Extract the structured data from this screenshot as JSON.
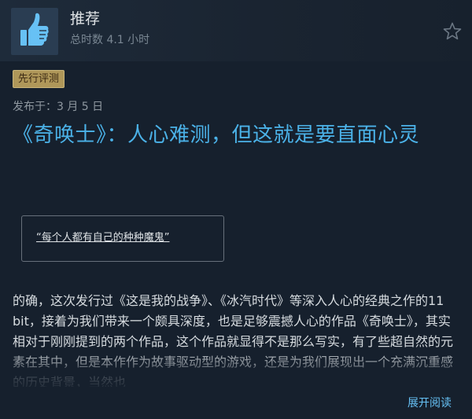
{
  "review": {
    "verdict": "推荐",
    "playtime": "总时数 4.1 小时",
    "badge": "先行评测",
    "posted": "发布于：3 月 5 日",
    "title": "《奇唤士》：人心难测，但这就是要直面心灵",
    "quote": "“每个人都有自己的种种魔鬼”",
    "body": "的确，这次发行过《这是我的战争》、《冰汽时代》等深入人心的经典之作的11 bit，接着为我们带来一个颇具深度，也是足够震撼人心的作品《奇唤士》，其实相对于刚刚提到的两个作品，这个作品就显得不是那么写实，有了些超自然的元素在其中，但是本作作为故事驱动型的游戏，还是为我们展现出一个充满沉重感的历史背景，当然也",
    "read_more": "展开阅读"
  },
  "icons": {
    "verdict_icon": "thumbs-up-icon",
    "favorite_icon": "star-outline-icon"
  },
  "colors": {
    "title": "#4bb2e8",
    "link": "#66c0f4",
    "badge_bg": "#af9759"
  }
}
